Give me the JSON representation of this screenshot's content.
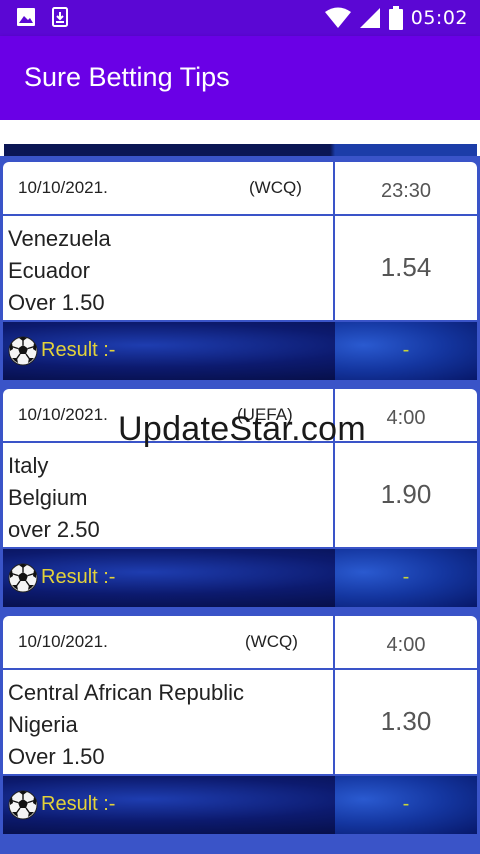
{
  "status_bar": {
    "time": "05:02",
    "icons": [
      "image-icon",
      "download-icon",
      "wifi-icon",
      "signal-icon",
      "battery-icon"
    ]
  },
  "app_bar": {
    "title": "Sure Betting Tips"
  },
  "colors": {
    "status_bar": "#5b07d4",
    "app_bar": "#6a00e6",
    "card_border": "#3a54c8",
    "result_text": "#e3d23a"
  },
  "tips": [
    {
      "date": "10/10/2021.",
      "league": "(WCQ)",
      "time": "23:30",
      "team1": "Venezuela",
      "team2": "Ecuador",
      "market": "Over 1.50",
      "odds": "1.54",
      "result_label": "Result :-",
      "result": "-"
    },
    {
      "date": "10/10/2021.",
      "league": "(UEFA)",
      "time": "4:00",
      "team1": "Italy",
      "team2": "Belgium",
      "market": "over 2.50",
      "odds": "1.90",
      "result_label": "Result :-",
      "result": "-"
    },
    {
      "date": "10/10/2021.",
      "league": "(WCQ)",
      "time": "4:00",
      "team1": "Central African Republic",
      "team2": "Nigeria",
      "market": "Over 1.50",
      "odds": "1.30",
      "result_label": "Result :-",
      "result": "-"
    }
  ],
  "watermark": "UpdateStar.com"
}
